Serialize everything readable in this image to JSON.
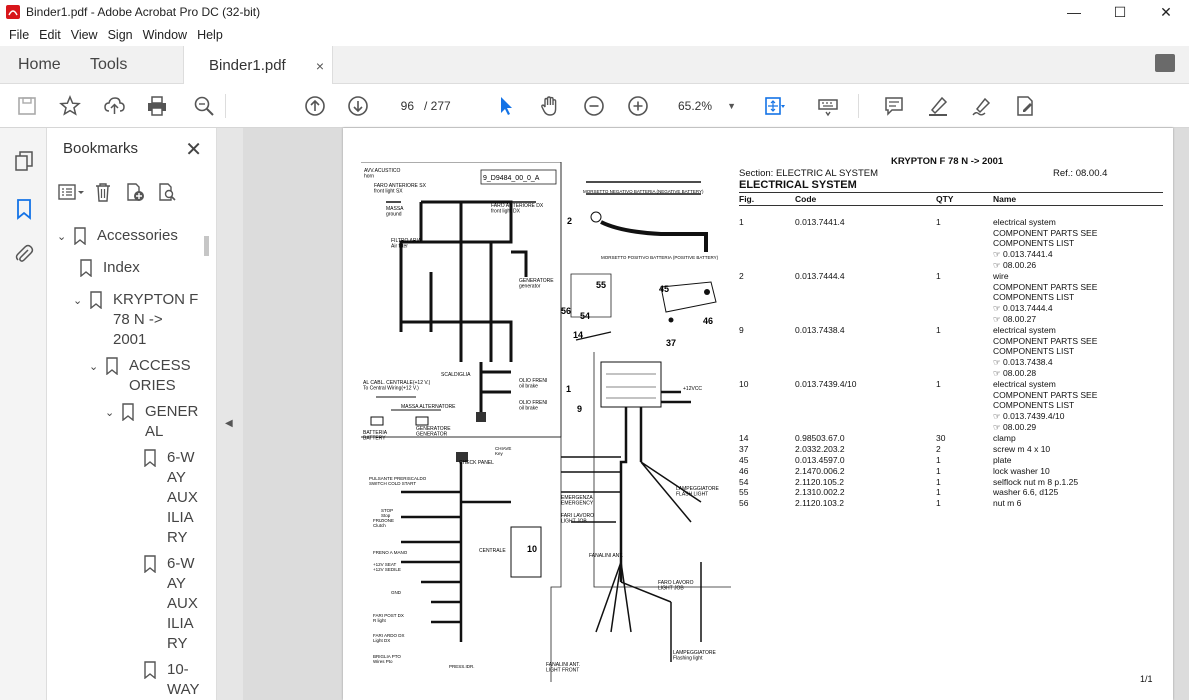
{
  "window": {
    "title": "Binder1.pdf - Adobe Acrobat Pro DC (32-bit)",
    "min": "—",
    "max": "☐",
    "close": "✕"
  },
  "menu": [
    "File",
    "Edit",
    "View",
    "Sign",
    "Window",
    "Help"
  ],
  "tabs": {
    "home": "Home",
    "tools": "Tools",
    "doc": "Binder1.pdf",
    "close": "×"
  },
  "toolbar": {
    "page_current": "96",
    "page_total": "/ 277",
    "zoom": "65.2%"
  },
  "bookmarks": {
    "title": "Bookmarks",
    "close": "✕",
    "items": [
      {
        "label": "Accessories",
        "chev": "⌄"
      },
      {
        "label": "Index",
        "chev": ""
      },
      {
        "label": "KRYPTON F\n78 N ->\n2001",
        "chev": "⌄"
      },
      {
        "label": "ACCESS\nORIES",
        "chev": "⌄"
      },
      {
        "label": "GENER\nAL",
        "chev": "⌄"
      },
      {
        "label": "6-W\nAY\nAUX\nILIA\nRY",
        "chev": ""
      },
      {
        "label": "6-W\nAY\nAUX\nILIA\nRY",
        "chev": ""
      },
      {
        "label": "10-\nWAY",
        "chev": ""
      }
    ]
  },
  "document": {
    "title": "KRYPTON F 78 N -> 2001",
    "section": "Section: ELECTRIC AL SYSTEM",
    "ref": "Ref.: 08.00.4",
    "heading": "ELECTRICAL SYSTEM",
    "columns": {
      "fig": "Fig.",
      "code": "Code",
      "qty": "QTY",
      "name": "Name"
    },
    "rows": [
      {
        "fig": "1",
        "code": "0.013.7441.4",
        "qty": "1",
        "name": "electrical system\nCOMPONENT PARTS SEE\nCOMPONENTS LIST\n☞ 0.013.7441.4\n☞ 08.00.26"
      },
      {
        "fig": "2",
        "code": "0.013.7444.4",
        "qty": "1",
        "name": "wire\nCOMPONENT PARTS SEE\nCOMPONENTS LIST\n☞ 0.013.7444.4\n☞ 08.00.27"
      },
      {
        "fig": "9",
        "code": "0.013.7438.4",
        "qty": "1",
        "name": "electrical system\nCOMPONENT PARTS SEE\nCOMPONENTS LIST\n☞ 0.013.7438.4\n☞ 08.00.28"
      },
      {
        "fig": "10",
        "code": "0.013.7439.4/10",
        "qty": "1",
        "name": "electrical system\nCOMPONENT PARTS SEE\nCOMPONENTS LIST\n☞ 0.013.7439.4/10\n☞ 08.00.29"
      },
      {
        "fig": "14",
        "code": "0.98503.67.0",
        "qty": "30",
        "name": "clamp"
      },
      {
        "fig": "37",
        "code": "2.0332.203.2",
        "qty": "2",
        "name": "screw m 4 x 10"
      },
      {
        "fig": "45",
        "code": "0.013.4597.0",
        "qty": "1",
        "name": "plate"
      },
      {
        "fig": "46",
        "code": "2.1470.006.2",
        "qty": "1",
        "name": "lock washer 10"
      },
      {
        "fig": "54",
        "code": "2.1120.105.2",
        "qty": "1",
        "name": "selflock nut m 8 p.1.25"
      },
      {
        "fig": "55",
        "code": "2.1310.002.2",
        "qty": "1",
        "name": "washer 6.6, d125"
      },
      {
        "fig": "56",
        "code": "2.1120.103.2",
        "qty": "1",
        "name": "nut m 6"
      }
    ],
    "page_footer": "1/1",
    "diagram_labels": {
      "drawing_id": "9_D9484_00_0_A",
      "horn": "AVV.ACUSTICO\nhorn",
      "faro_sx": "FARO ANTERIORE SX\nfront light SX",
      "faro_dx": "FARO ANTERIORE DX\nfront light DX",
      "massa": "MASSA\nground",
      "filtro": "FILTRO ARIA\nAir filter",
      "generatore": "GENERATORE\ngenerator",
      "olio_freni1": "OLIO FRENI\noil brake",
      "olio_freni2": "OLIO FRENI\noil brake",
      "scaldiglia": "SCALDIGLIA",
      "cabina": "AL CABL. CENTRALE(+12 V.)\nTo Central Wiring(+12 V.)",
      "massa_alt": "MASSA ALTERNATORE",
      "batteria": "BATTERIA\nBATTERY",
      "generatore2": "GENERATORE\nGENERATOR",
      "morsetto_neg": "MORSETTO NEGATIVO BATTERIA (NEGATIVE BATTERY)",
      "morsetto_pos": "MORSETTO POSITIVO BATTERIA (POSITIVE BATTERY)",
      "check_panel": "CHECK PANEL",
      "chiave": "CHIAVE\nKey",
      "centrale": "CENTRALE",
      "emergenza": "EMERGENZA\nEMERGENCY",
      "fari_lavoro": "FARI LAVORO\nLIGHT JOB",
      "lampeggiatore": "LAMPEGGIATORE\nFLASH LIGHT",
      "fanalini_ant": "FANALINI ANT.",
      "faro_lavoro": "FARO LAVORO\nLIGHT JOB",
      "fanalini_ant2": "FANALINI ANT.\nLIGHT FRONT",
      "lampeggiatore2": "LAMPEGGIATORE\nFlashing light",
      "plus12": "+12VCC",
      "preriscaldo": "PULSANTE PRERISCALDO\nSWITCH COLD START",
      "stop": "STOP\nStop",
      "frizione": "FRIZIONE\nClutch",
      "freno": "FRENO A MANO",
      "sedile": "+12V SEAT\n+12V SEDILE",
      "gnd": "GND",
      "fari_post_dx": "FARI POST DX\nR light",
      "fari_post_sx": "FARI ARDO DX\nLight DX",
      "briglia": "BRIGLIA PTO\nWires Pto",
      "pressdr": "PRESS.IDR.",
      "n1": "1",
      "n2": "2",
      "n9": "9",
      "n10": "10",
      "n14": "14",
      "n37": "37",
      "n45": "45",
      "n46": "46",
      "n54": "54",
      "n55": "55",
      "n56": "56"
    }
  }
}
